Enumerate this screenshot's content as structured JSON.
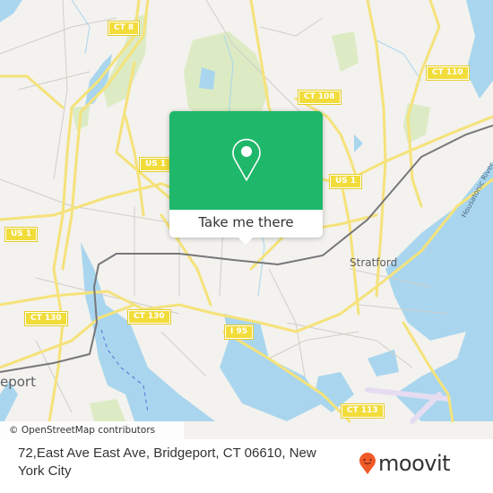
{
  "map": {
    "popup": {
      "icon": "location-pin-icon",
      "button_label": "Take me there",
      "accent_color": "#1fb76a"
    },
    "road_shields": [
      {
        "label": "CT 8"
      },
      {
        "label": "CT 108"
      },
      {
        "label": "CT 110"
      },
      {
        "label": "US 1"
      },
      {
        "label": "US 1"
      },
      {
        "label": "US 1"
      },
      {
        "label": "CT 130"
      },
      {
        "label": "CT 130"
      },
      {
        "label": "I 95"
      },
      {
        "label": "CT 113"
      }
    ],
    "place_labels": {
      "stratford": "Stratford",
      "bridgeport": "eport",
      "river": "Housatonic River"
    },
    "attribution": "© OpenStreetMap contributors"
  },
  "footer": {
    "address": "72,East Ave East Ave, Bridgeport, CT 06610, New York City",
    "brand": "moovit",
    "brand_color": "#f05a28"
  }
}
